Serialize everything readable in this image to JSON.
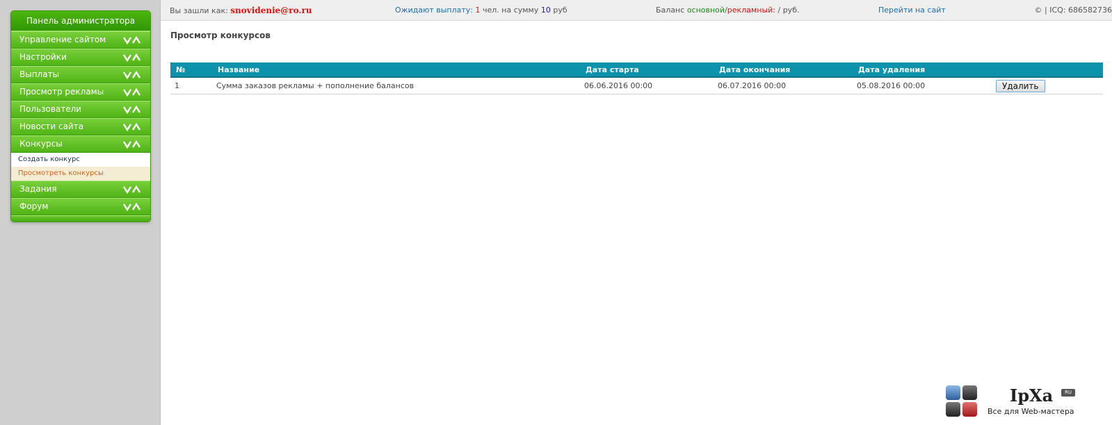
{
  "sidebar": {
    "header": "Панель администратора",
    "items": [
      {
        "label": "Управление сайтом"
      },
      {
        "label": "Настройки"
      },
      {
        "label": "Выплаты"
      },
      {
        "label": "Просмотр рекламы"
      },
      {
        "label": "Пользователи"
      },
      {
        "label": "Новости сайта"
      },
      {
        "label": "Конкурсы"
      }
    ],
    "submenu": [
      {
        "label": "Создать конкурс"
      },
      {
        "label": "Просмотреть конкурсы"
      }
    ],
    "items_after": [
      {
        "label": "Задания"
      },
      {
        "label": "Форум"
      }
    ]
  },
  "topbar": {
    "logged_in_label": "Вы зашли как:",
    "login": "snovidenie@ro.ru",
    "pending_label": "Ожидают выплату:",
    "pending_count": "1",
    "people_label": "чел. на сумму",
    "pending_sum": "10",
    "currency": "руб",
    "balance_label": "Баланс",
    "balance_main_label": "основной",
    "slash": "/",
    "balance_ad_label": "рекламный:",
    "balance_value": "/ руб.",
    "site_link": "Перейти на сайт",
    "copyright": "© | ICQ: 686582736"
  },
  "page": {
    "title": "Просмотр конкурсов"
  },
  "table": {
    "headers": [
      "№",
      "Название",
      "Дата старта",
      "Дата окончания",
      "Дата удаления"
    ],
    "rows": [
      {
        "num": "1",
        "name": "Сумма заказов рекламы + пополнение балансов",
        "start": "06.06.2016 00:00",
        "end": "06.07.2016 00:00",
        "delete_date": "05.08.2016 00:00",
        "action": "Удалить"
      }
    ]
  },
  "logo": {
    "brand": "IpXa",
    "badge": "RU",
    "tagline": "Все для Web-мастера"
  },
  "colors": {
    "menu_green": "#58b81b",
    "table_header": "#0d92ab",
    "accent_red": "#e01010",
    "active_sub": "#d0661e"
  }
}
